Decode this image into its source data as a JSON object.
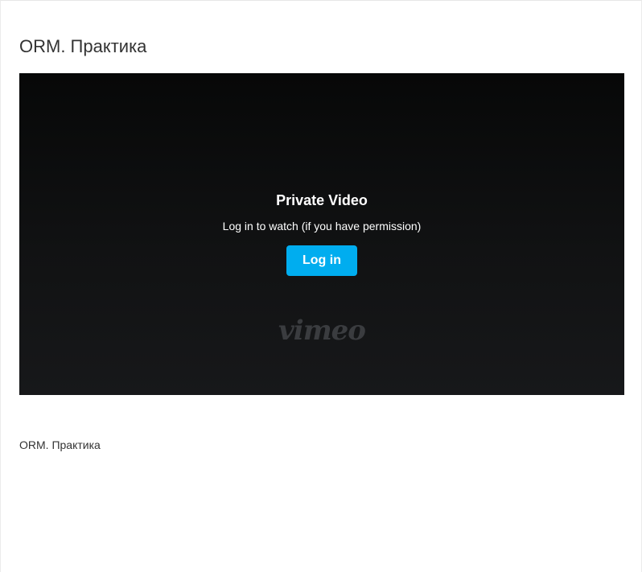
{
  "page": {
    "title": "ORM. Практика",
    "description": "ORM. Практика"
  },
  "video": {
    "overlay_title": "Private Video",
    "overlay_subtitle": "Log in to watch (if you have permission)",
    "login_label": "Log in",
    "logo_text": "vimeo",
    "accent_color": "#00adef"
  }
}
